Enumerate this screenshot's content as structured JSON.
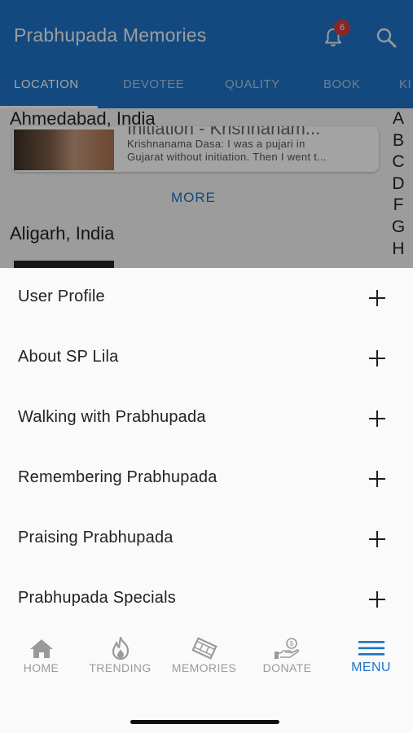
{
  "app": {
    "title": "Prabhupada Memories",
    "notification_count": "6"
  },
  "tabs": [
    {
      "label": "LOCATION"
    },
    {
      "label": "DEVOTEE"
    },
    {
      "label": "QUALITY"
    },
    {
      "label": "BOOK"
    },
    {
      "label": "KI"
    }
  ],
  "content": {
    "section1": "Ahmedabad, India",
    "card": {
      "title": "Initiation - Krishnanam...",
      "line1": "Krishnanama Dasa: I was a pujari in",
      "line2": "Gujarat without initiation. Then I went t..."
    },
    "more_label": "MORE",
    "section2": "Aligarh, India",
    "alphabet": [
      "A",
      "B",
      "C",
      "D",
      "F",
      "G",
      "H"
    ]
  },
  "menu": [
    {
      "label": "User Profile"
    },
    {
      "label": "About SP Lila"
    },
    {
      "label": "Walking with Prabhupada"
    },
    {
      "label": "Remembering Prabhupada"
    },
    {
      "label": "Praising Prabhupada"
    },
    {
      "label": "Prabhupada Specials"
    }
  ],
  "bottom_nav": [
    {
      "label": "HOME",
      "icon": "home-icon"
    },
    {
      "label": "TRENDING",
      "icon": "fire-icon"
    },
    {
      "label": "MEMORIES",
      "icon": "film-icon"
    },
    {
      "label": "DONATE",
      "icon": "donate-hand-icon"
    },
    {
      "label": "MENU",
      "icon": "hamburger-icon",
      "active": true
    }
  ],
  "colors": {
    "primary": "#1f72c6",
    "badge": "#d93b3b",
    "inactive_nav": "#9a9a9a"
  }
}
